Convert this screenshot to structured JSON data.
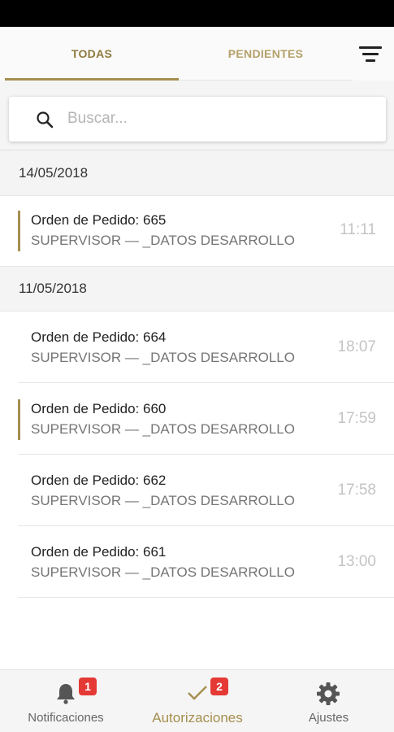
{
  "tabs": {
    "items": [
      {
        "label": "TODAS"
      },
      {
        "label": "PENDIENTES"
      }
    ]
  },
  "search": {
    "placeholder": "Buscar..."
  },
  "groups": [
    {
      "date": "14/05/2018",
      "orders": [
        {
          "title": "Orden de Pedido: 665",
          "subtitle": "SUPERVISOR — _DATOS DESARROLLO",
          "time": "11:11",
          "pending": true
        }
      ]
    },
    {
      "date": "11/05/2018",
      "orders": [
        {
          "title": "Orden de Pedido: 664",
          "subtitle": "SUPERVISOR — _DATOS DESARROLLO",
          "time": "18:07",
          "pending": false
        },
        {
          "title": "Orden de Pedido: 660",
          "subtitle": "SUPERVISOR — _DATOS DESARROLLO",
          "time": "17:59",
          "pending": true
        },
        {
          "title": "Orden de Pedido: 662",
          "subtitle": "SUPERVISOR — _DATOS DESARROLLO",
          "time": "17:58",
          "pending": false
        },
        {
          "title": "Orden de Pedido: 661",
          "subtitle": "SUPERVISOR — _DATOS DESARROLLO",
          "time": "13:00",
          "pending": false
        }
      ]
    }
  ],
  "bottom_nav": {
    "items": [
      {
        "label": "Notificaciones",
        "icon": "bell-icon",
        "badge": "1"
      },
      {
        "label": "Autorizaciones",
        "icon": "check-icon",
        "badge": "2"
      },
      {
        "label": "Ajustes",
        "icon": "gear-icon"
      }
    ]
  },
  "colors": {
    "accent": "#a58f4f",
    "badge": "#e53935"
  }
}
